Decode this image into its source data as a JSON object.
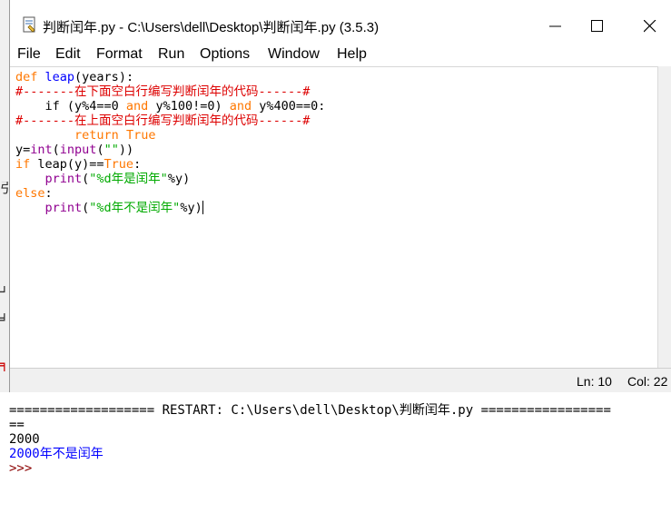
{
  "editor": {
    "title": "判断闰年.py - C:\\Users\\dell\\Desktop\\判断闰年.py (3.5.3)",
    "menu": [
      "File",
      "Edit",
      "Format",
      "Run",
      "Options",
      "Window",
      "Help"
    ],
    "code": {
      "l1a": "def",
      "l1b": " ",
      "l1c": "leap",
      "l1d": "(years):",
      "l2": "#-------在下面空白行编写判断闰年的代码------#",
      "l3a": "    if (y%4==0 ",
      "l3b": "and",
      "l3c": " y%100!=0) ",
      "l3d": "and",
      "l3e": " y%400==0:",
      "l4": "#-------在上面空白行编写判断闰年的代码------#",
      "l5a": "        ",
      "l5b": "return",
      "l5c": " ",
      "l5d": "True",
      "l6a": "y=",
      "l6b": "int",
      "l6c": "(",
      "l6d": "input",
      "l6e": "(",
      "l6f": "\"\"",
      "l6g": "))",
      "l7a": "if",
      "l7b": " leap(y)==",
      "l7c": "True",
      "l7d": ":",
      "l8a": "    ",
      "l8b": "print",
      "l8c": "(",
      "l8d": "\"%d年是闰年\"",
      "l8e": "%y)",
      "l9a": "else",
      "l9b": ":",
      "l10a": "    ",
      "l10b": "print",
      "l10c": "(",
      "l10d": "\"%d年不是闰年\"",
      "l10e": "%y)"
    },
    "status": {
      "line": "Ln: 10",
      "col": "Col: 22"
    }
  },
  "shell": {
    "restart": "=================== RESTART: C:\\Users\\dell\\Desktop\\判断闰年.py =================",
    "restart_tail": "==",
    "input_value": "2000",
    "output": "2000年不是闰年",
    "prompt": ">>>"
  },
  "colors": {
    "keyword": "#ff7700",
    "definition": "#0000ff",
    "comment": "#dd0000",
    "string": "#00aa00",
    "builtin": "#900090",
    "shell_output": "#0000ff",
    "shell_prompt": "#8b0000"
  }
}
